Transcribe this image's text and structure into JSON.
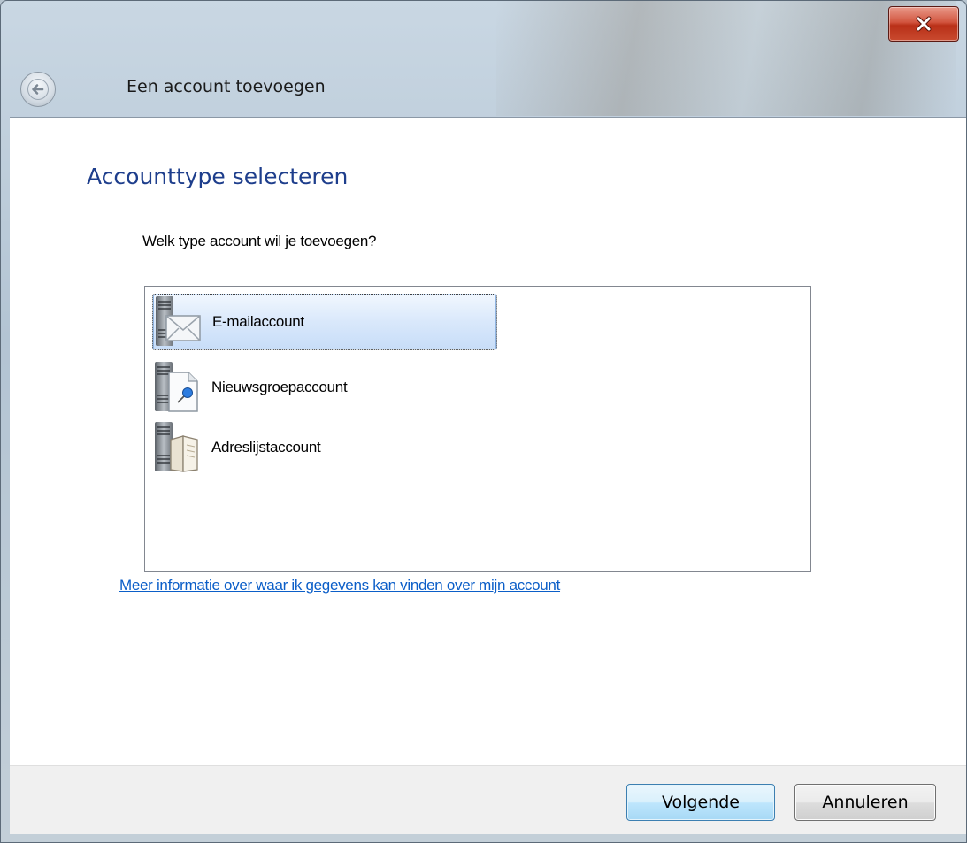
{
  "window": {
    "title": "Een account toevoegen",
    "close_icon": "close-x-icon",
    "back_icon": "back-arrow-icon"
  },
  "page": {
    "heading": "Accounttype selecteren",
    "question": "Welk type account wil je toevoegen?"
  },
  "account_types": [
    {
      "label": "E-mailaccount",
      "icon": "mail-server-icon",
      "selected": true
    },
    {
      "label": "Nieuwsgroepaccount",
      "icon": "newsgroup-server-icon",
      "selected": false
    },
    {
      "label": "Adreslijstaccount",
      "icon": "directory-server-icon",
      "selected": false
    }
  ],
  "help_link": "Meer informatie over waar ik gegevens kan vinden over mijn account",
  "buttons": {
    "next": {
      "pre": "V",
      "accel": "o",
      "post": "lgende"
    },
    "cancel": "Annuleren"
  },
  "colors": {
    "heading": "#1e3e8c",
    "link": "#0b5ec8",
    "selection": "#c7ddf8"
  }
}
